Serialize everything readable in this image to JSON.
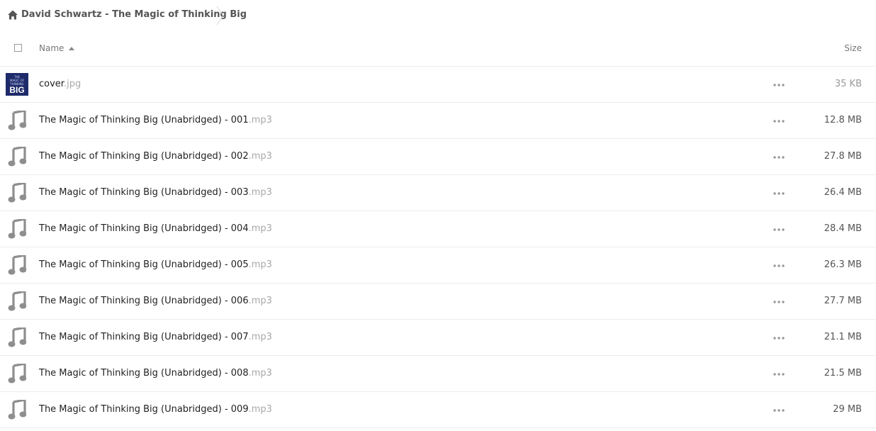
{
  "breadcrumb": {
    "home_icon": "home-icon",
    "title": "David Schwartz - The Magic of Thinking Big"
  },
  "header": {
    "name_label": "Name",
    "size_label": "Size",
    "sort_icon": "sort-ascending-icon"
  },
  "cover_thumb": {
    "line1": "THE",
    "line2": "MAGIC OF",
    "line3": "THINKING",
    "line4": "BIG"
  },
  "files": [
    {
      "base": "cover",
      "ext": ".jpg",
      "size": "35 KB",
      "icon": "image-thumbnail"
    },
    {
      "base": "The Magic of Thinking Big (Unabridged) - 001",
      "ext": ".mp3",
      "size": "12.8 MB",
      "icon": "music-note-icon"
    },
    {
      "base": "The Magic of Thinking Big (Unabridged) - 002",
      "ext": ".mp3",
      "size": "27.8 MB",
      "icon": "music-note-icon"
    },
    {
      "base": "The Magic of Thinking Big (Unabridged) - 003",
      "ext": ".mp3",
      "size": "26.4 MB",
      "icon": "music-note-icon"
    },
    {
      "base": "The Magic of Thinking Big (Unabridged) - 004",
      "ext": ".mp3",
      "size": "28.4 MB",
      "icon": "music-note-icon"
    },
    {
      "base": "The Magic of Thinking Big (Unabridged) - 005",
      "ext": ".mp3",
      "size": "26.3 MB",
      "icon": "music-note-icon"
    },
    {
      "base": "The Magic of Thinking Big (Unabridged) - 006",
      "ext": ".mp3",
      "size": "27.7 MB",
      "icon": "music-note-icon"
    },
    {
      "base": "The Magic of Thinking Big (Unabridged) - 007",
      "ext": ".mp3",
      "size": "21.1 MB",
      "icon": "music-note-icon"
    },
    {
      "base": "The Magic of Thinking Big (Unabridged) - 008",
      "ext": ".mp3",
      "size": "21.5 MB",
      "icon": "music-note-icon"
    },
    {
      "base": "The Magic of Thinking Big (Unabridged) - 009",
      "ext": ".mp3",
      "size": "29 MB",
      "icon": "music-note-icon"
    }
  ],
  "colors": {
    "icon_gray": "#8e8e8e",
    "cover_bg": "#1e2a6a",
    "divider": "#ededed"
  }
}
